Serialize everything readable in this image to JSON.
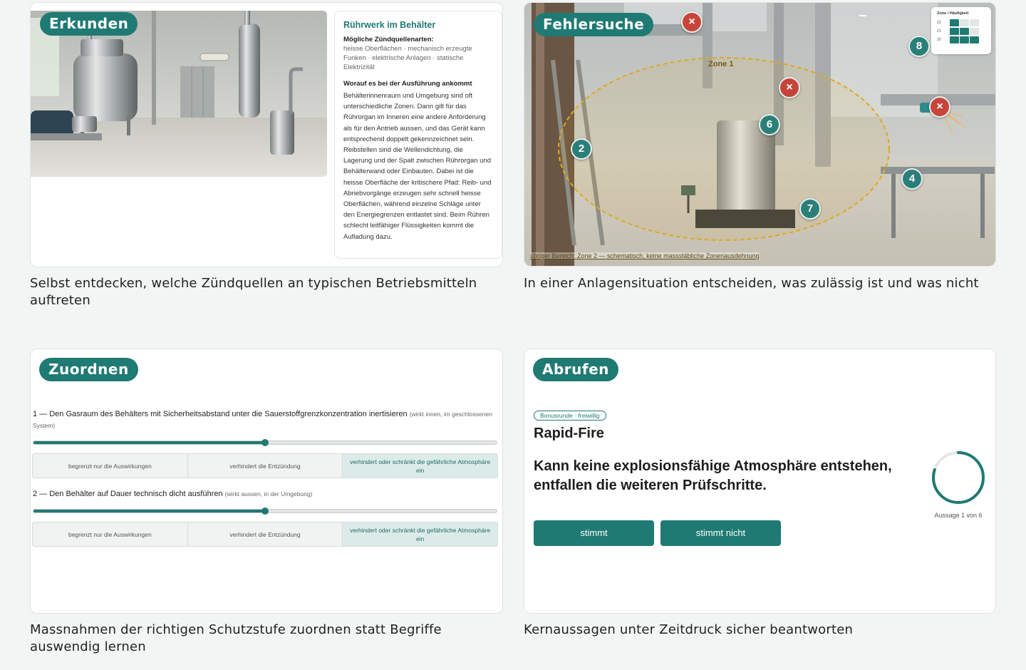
{
  "cards": {
    "explore": {
      "pill": "Erkunden",
      "caption": "Selbst entdecken, welche Zündquellen an typischen Betriebsmitteln auftreten",
      "info_title": "Rührwerk im Behälter",
      "sources_heading": "Mögliche Zündquellenarten:",
      "sources": "heisse Oberflächen · mechanisch erzeugte Funken · elektrische Anlagen · statische Elektrizität",
      "body_heading": "Worauf es bei der Ausführung ankommt",
      "body": "Behälterinnenraum und Umgebung sind oft unterschiedliche Zonen. Dann gilt für das Rührorgan im Inneren eine andere Anforderung als für den Antrieb aussen, und das Gerät kann entsprechend doppelt gekennzeichnet sein. Reibstellen sind die Wellendichtung, die Lagerung und der Spalt zwischen Rührorgan und Behälterwand oder Einbauten. Dabei ist die heisse Oberfläche der kritischere Pfad: Reib- und Abriebvorgänge erzeugen sehr schnell heisse Oberflächen, während einzelne Schläge unter den Energiegrenzen entlastet sind. Beim Rühren schlecht leitfähiger Flüssigkeiten kommt die Aufladung dazu."
    },
    "troubleshoot": {
      "pill": "Fehlersuche",
      "caption": "In einer Anlagensituation entscheiden, was zulässig ist und was nicht",
      "zone_label": "Zone 1",
      "footnote": "übriger Bereich: Zone 2 — schematisch, keine massstäbliche Zonenausdehnung",
      "legend_title": "Zone / Häufigkeit",
      "legend_rows": [
        "Z2",
        "Z1",
        "Z0"
      ],
      "markers": {
        "m2": "2",
        "m4": "4",
        "m6": "6",
        "m7": "7",
        "m8": "8",
        "err": "×"
      },
      "colors": {
        "numbered": "#2b7f79",
        "error": "#c7443a",
        "zone": "#e0a820"
      }
    },
    "assign": {
      "pill": "Zuordnen",
      "caption": "Massnahmen der richtigen Schutzstufe zuordnen statt Begriffe auswendig lernen",
      "items": [
        {
          "text": "1 — Den Gasraum des Behälters mit Sicherheitsabstand unter die Sauerstoffgrenzkonzentration inertisieren",
          "hint": "(wirkt innen, im geschlossenen System)",
          "level": 0.5
        },
        {
          "text": "2 — Den Behälter auf Dauer technisch dicht ausführen",
          "hint": "(wirkt aussen, in der Umgebung)",
          "level": 0.5
        }
      ],
      "options": [
        "begrenzt nur die Auswirkungen",
        "verhindert die Entzündung",
        "verhindert oder schränkt die gefährliche Atmosphäre ein"
      ]
    },
    "recall": {
      "pill": "Abrufen",
      "caption": "Kernaussagen unter Zeitdruck sicher beantworten",
      "badge": "Bonusrunde · freiwillig",
      "title": "Rapid-Fire",
      "statement": "Kann keine explosionsfähige Atmosphäre entstehen, entfallen die weiteren Prüfschritte.",
      "btn_true": "stimmt",
      "btn_false": "stimmt nicht",
      "counter": "Aussage 1 von 6",
      "timer_fraction": 0.8,
      "accent": "#1f7a73"
    }
  }
}
